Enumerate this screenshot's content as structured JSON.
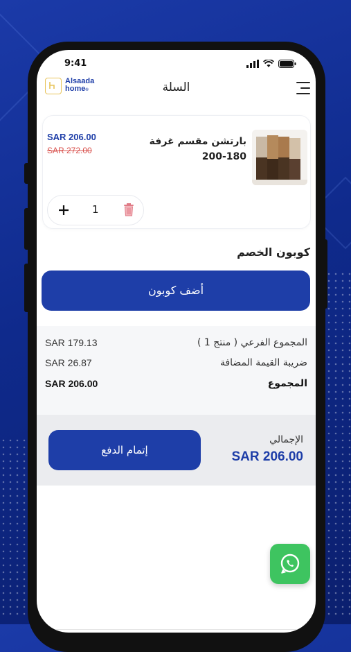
{
  "status_bar": {
    "time": "9:41"
  },
  "header": {
    "logo_line1": "Alsaada",
    "logo_line2": "home",
    "title": "السلة"
  },
  "cart_item": {
    "name": "بارتشن مقسم غرفة 180-200",
    "price_current": "SAR 206.00",
    "price_original": "SAR 272.00",
    "quantity": "1"
  },
  "coupon": {
    "title": "كوبون الخصم",
    "button_label": "أضف كوبون"
  },
  "summary": {
    "subtotal_label": "المجموع الفرعي ( منتج 1 )",
    "subtotal_value": "SAR 179.13",
    "vat_label": "ضريبة القيمة المضافة",
    "vat_value": "SAR 26.87",
    "total_label": "المجموع",
    "total_value": "SAR 206.00"
  },
  "checkout": {
    "grand_total_label": "الإجمالي",
    "grand_total_value": "SAR 206.00",
    "pay_button_label": "إتمام الدفع"
  },
  "colors": {
    "primary": "#1e3ea8",
    "old_price": "#d9534f",
    "whatsapp": "#3ec460"
  },
  "icons": [
    "signal-icon",
    "wifi-icon",
    "battery-icon",
    "menu-icon",
    "plus-icon",
    "trash-icon",
    "whatsapp-icon"
  ]
}
